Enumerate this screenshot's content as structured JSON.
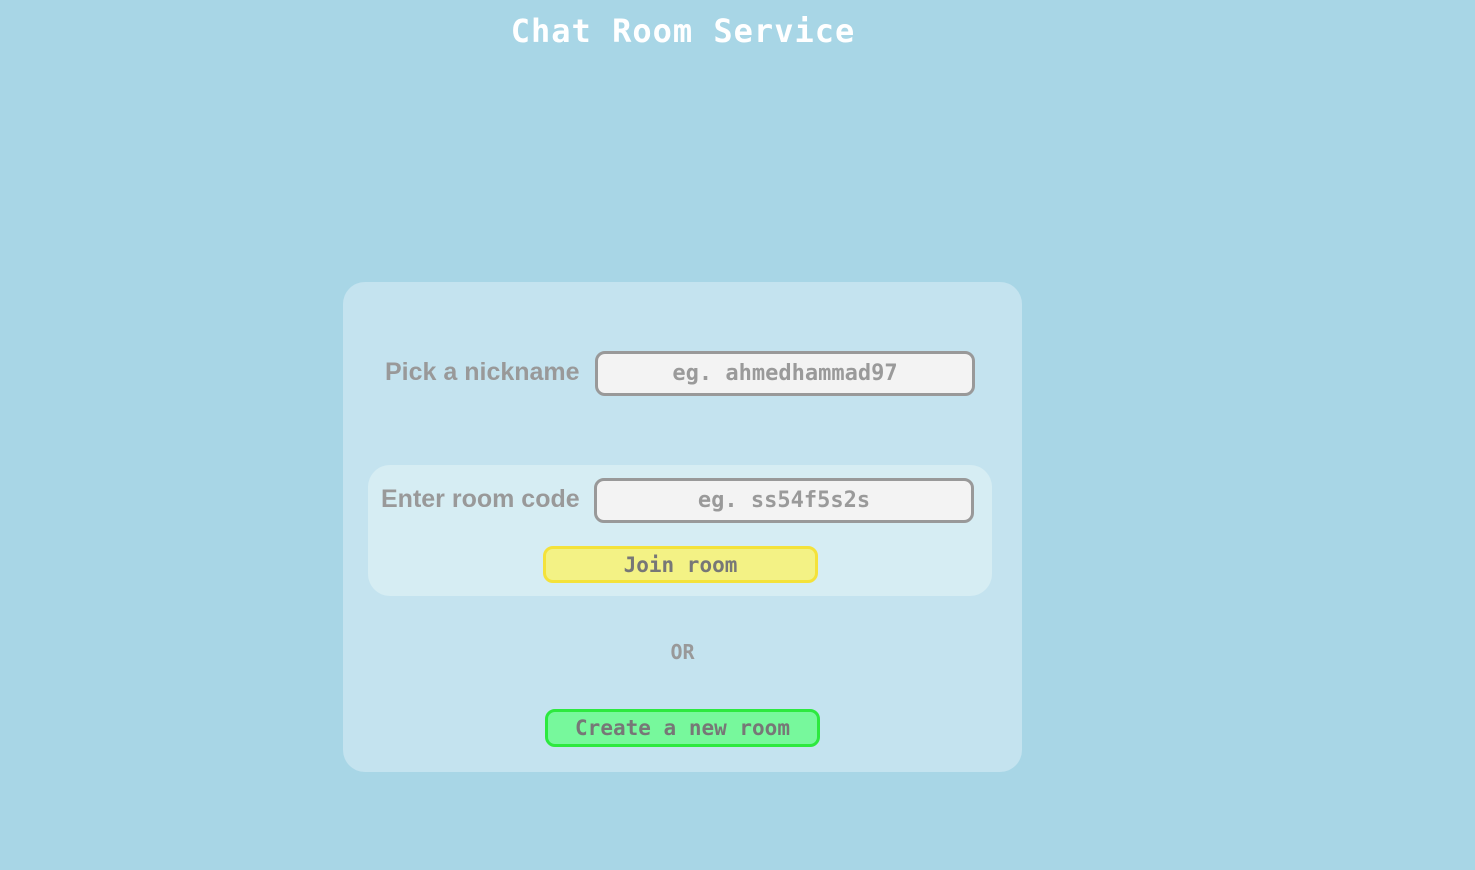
{
  "header": {
    "title": "Chat Room Service"
  },
  "form": {
    "nickname": {
      "label": "Pick a nickname",
      "placeholder": "eg. ahmedhammad97",
      "value": ""
    },
    "room_code": {
      "label": "Enter room code",
      "placeholder": "eg. ss54f5s2s",
      "value": ""
    },
    "join_button_label": "Join room",
    "or_separator": "OR",
    "create_button_label": "Create a new room"
  },
  "colors": {
    "background": "#a8d6e6",
    "card": "#c4e3ef",
    "join_panel": "#d6edf3",
    "join_button_fill": "#f3f285",
    "join_button_border": "#f4e23a",
    "create_button_fill": "#77f89c",
    "create_button_border": "#2de93f",
    "label_text": "#999999"
  }
}
